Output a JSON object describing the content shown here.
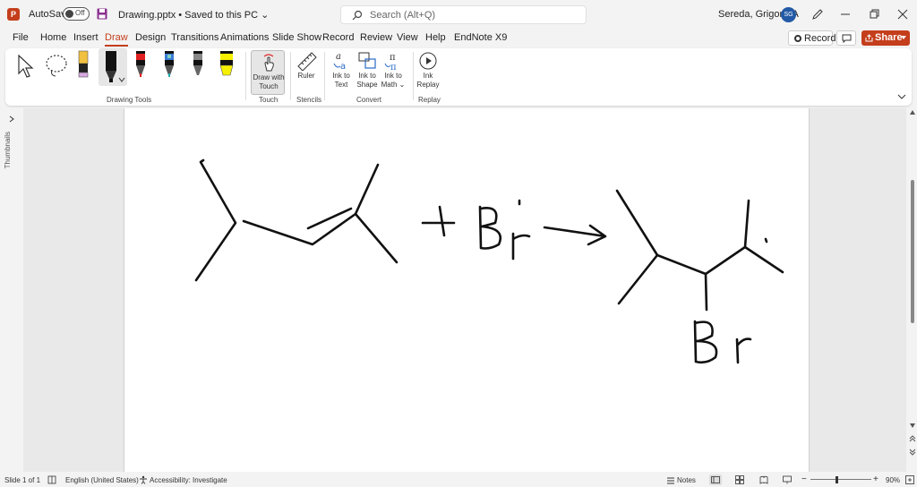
{
  "titlebar": {
    "app_logo": "P",
    "autosave_label": "AutoSave",
    "autosave_state": "Off",
    "doc_title": "Drawing.pptx • Saved to this PC ⌄",
    "search_placeholder": "Search (Alt+Q)",
    "user_name": "Sereda, Grigoriy A",
    "avatar_initials": "SG"
  },
  "tabs": [
    {
      "label": "File"
    },
    {
      "label": "Home"
    },
    {
      "label": "Insert"
    },
    {
      "label": "Draw"
    },
    {
      "label": "Design"
    },
    {
      "label": "Transitions"
    },
    {
      "label": "Animations"
    },
    {
      "label": "Slide Show"
    },
    {
      "label": "Record"
    },
    {
      "label": "Review"
    },
    {
      "label": "View"
    },
    {
      "label": "Help"
    },
    {
      "label": "EndNote X9"
    }
  ],
  "header_actions": {
    "record_label": "Record",
    "share_label": "Share"
  },
  "ribbon": {
    "groups": {
      "drawing_tools": "Drawing Tools",
      "touch": "Touch",
      "stencils": "Stencils",
      "convert": "Convert",
      "replay": "Replay"
    },
    "buttons": {
      "draw_with_touch": "Draw with Touch",
      "ruler": "Ruler",
      "ink_to_text": "Ink to Text",
      "ink_to_shape": "Ink to Shape",
      "ink_to_math": "Ink to Math ⌄",
      "ink_replay": "Ink Replay"
    }
  },
  "left_pane": {
    "thumbnails_label": "Thumbnails"
  },
  "slide": {
    "ink_labels": {
      "plus": "+",
      "reagent": "Br",
      "product_substituent": "Br"
    }
  },
  "statusbar": {
    "slide_info": "Slide 1 of 1",
    "language": "English (United States)",
    "accessibility": "Accessibility: Investigate",
    "notes": "Notes",
    "zoom": "90%"
  },
  "colors": {
    "accent": "#c43e1c",
    "avatar": "#235aa6"
  }
}
